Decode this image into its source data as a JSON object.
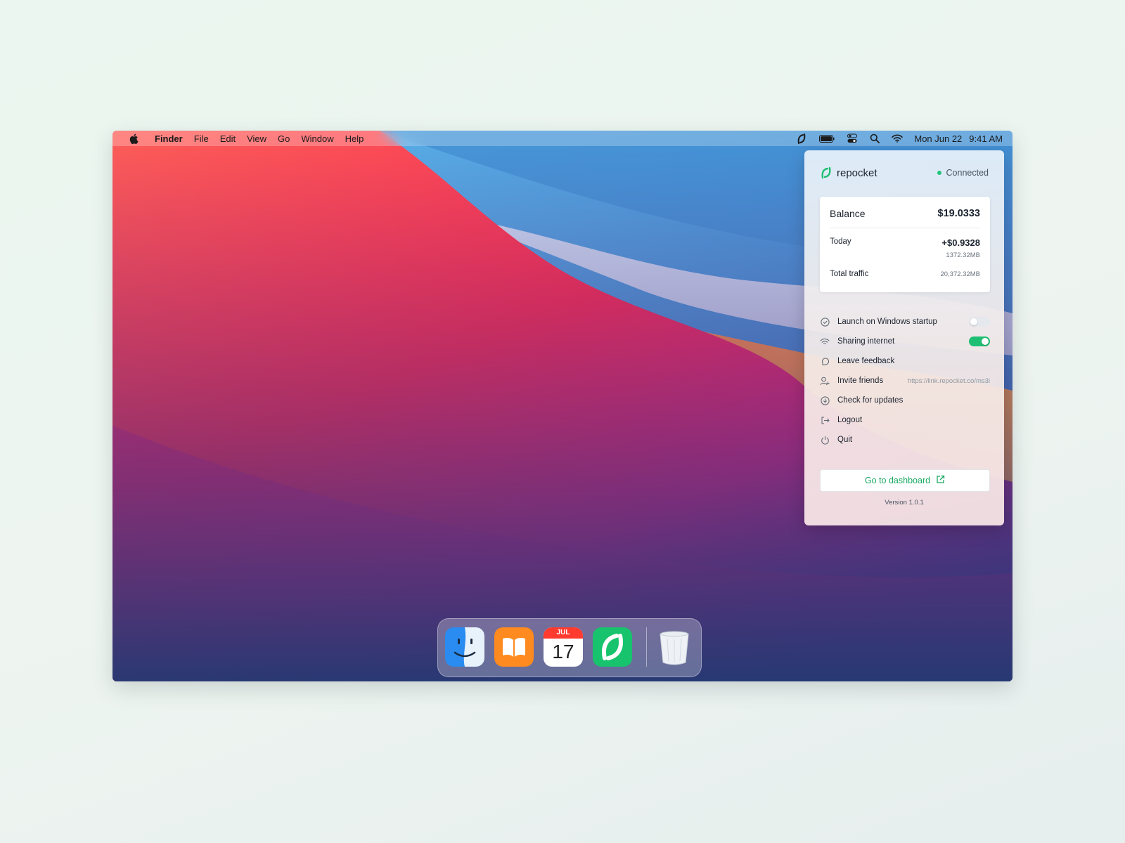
{
  "menubar": {
    "apple_icon": "apple-icon",
    "app_name": "Finder",
    "menus": [
      "File",
      "Edit",
      "View",
      "Go",
      "Window",
      "Help"
    ],
    "status_icons": [
      "repocket-icon",
      "battery-icon",
      "control-center-icon",
      "search-icon",
      "wifi-icon"
    ],
    "date": "Mon Jun 22",
    "time": "9:41 AM"
  },
  "panel": {
    "brand": "repocket",
    "status": "Connected",
    "status_color": "#22c47a",
    "balance_label": "Balance",
    "balance_value": "$19.0333",
    "today_label": "Today",
    "today_value": "+$0.9328",
    "today_traffic": "1372.32MB",
    "total_label": "Total traffic",
    "total_value": "20,372.32MB",
    "items": [
      {
        "label": "Launch on Windows startup",
        "icon": "check-circle-icon",
        "toggle": false
      },
      {
        "label": "Sharing internet",
        "icon": "wifi-icon",
        "toggle": true
      },
      {
        "label": "Leave feedback",
        "icon": "feedback-icon"
      },
      {
        "label": "Invite friends",
        "icon": "user-add-icon",
        "link": "https://link.repocket.co/ms3i"
      },
      {
        "label": "Check for updates",
        "icon": "download-icon"
      },
      {
        "label": "Logout",
        "icon": "logout-icon"
      },
      {
        "label": "Quit",
        "icon": "power-icon"
      }
    ],
    "dashboard_button": "Go to dashboard",
    "version": "Version 1.0.1",
    "accent": "#1fbf73"
  },
  "dock": {
    "items": [
      "finder-icon",
      "books-icon",
      "calendar-icon",
      "repocket-app-icon",
      "trash-icon"
    ],
    "calendar_month": "JUL",
    "calendar_day": "17"
  }
}
